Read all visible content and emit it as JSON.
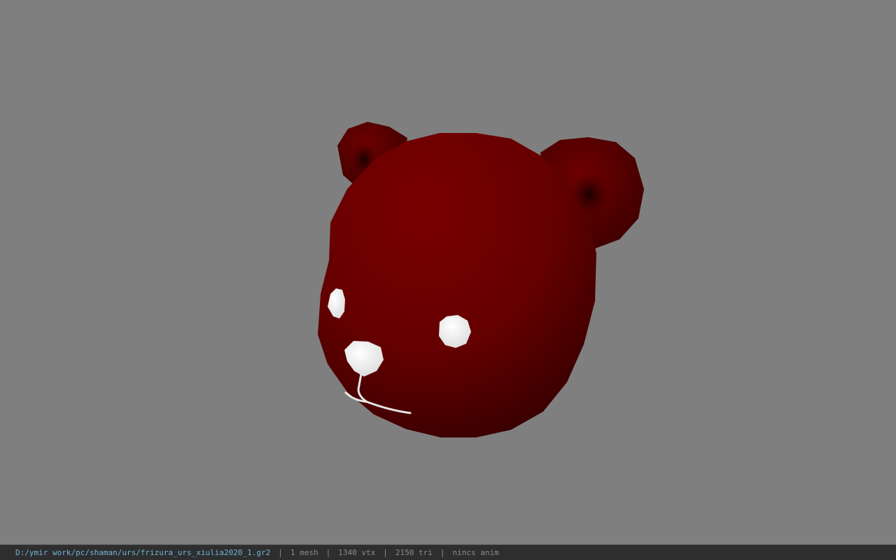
{
  "viewport": {
    "background_color": "#7f7f7f",
    "model": {
      "subject": "bear-head",
      "fur_color": "#6b0000",
      "feature_color": "#ffffff"
    }
  },
  "status_bar": {
    "file_path": "D:/ymir work/pc/shaman/urs/frizura_urs_xiulia2020_1.gr2",
    "separator": "|",
    "mesh_info": "1 mesh",
    "vertex_info": "1340 vtx",
    "triangle_info": "2150 tri",
    "anim_info": "nincs anim",
    "path_color": "#6fb6d6",
    "text_color": "#8c8c8c"
  }
}
